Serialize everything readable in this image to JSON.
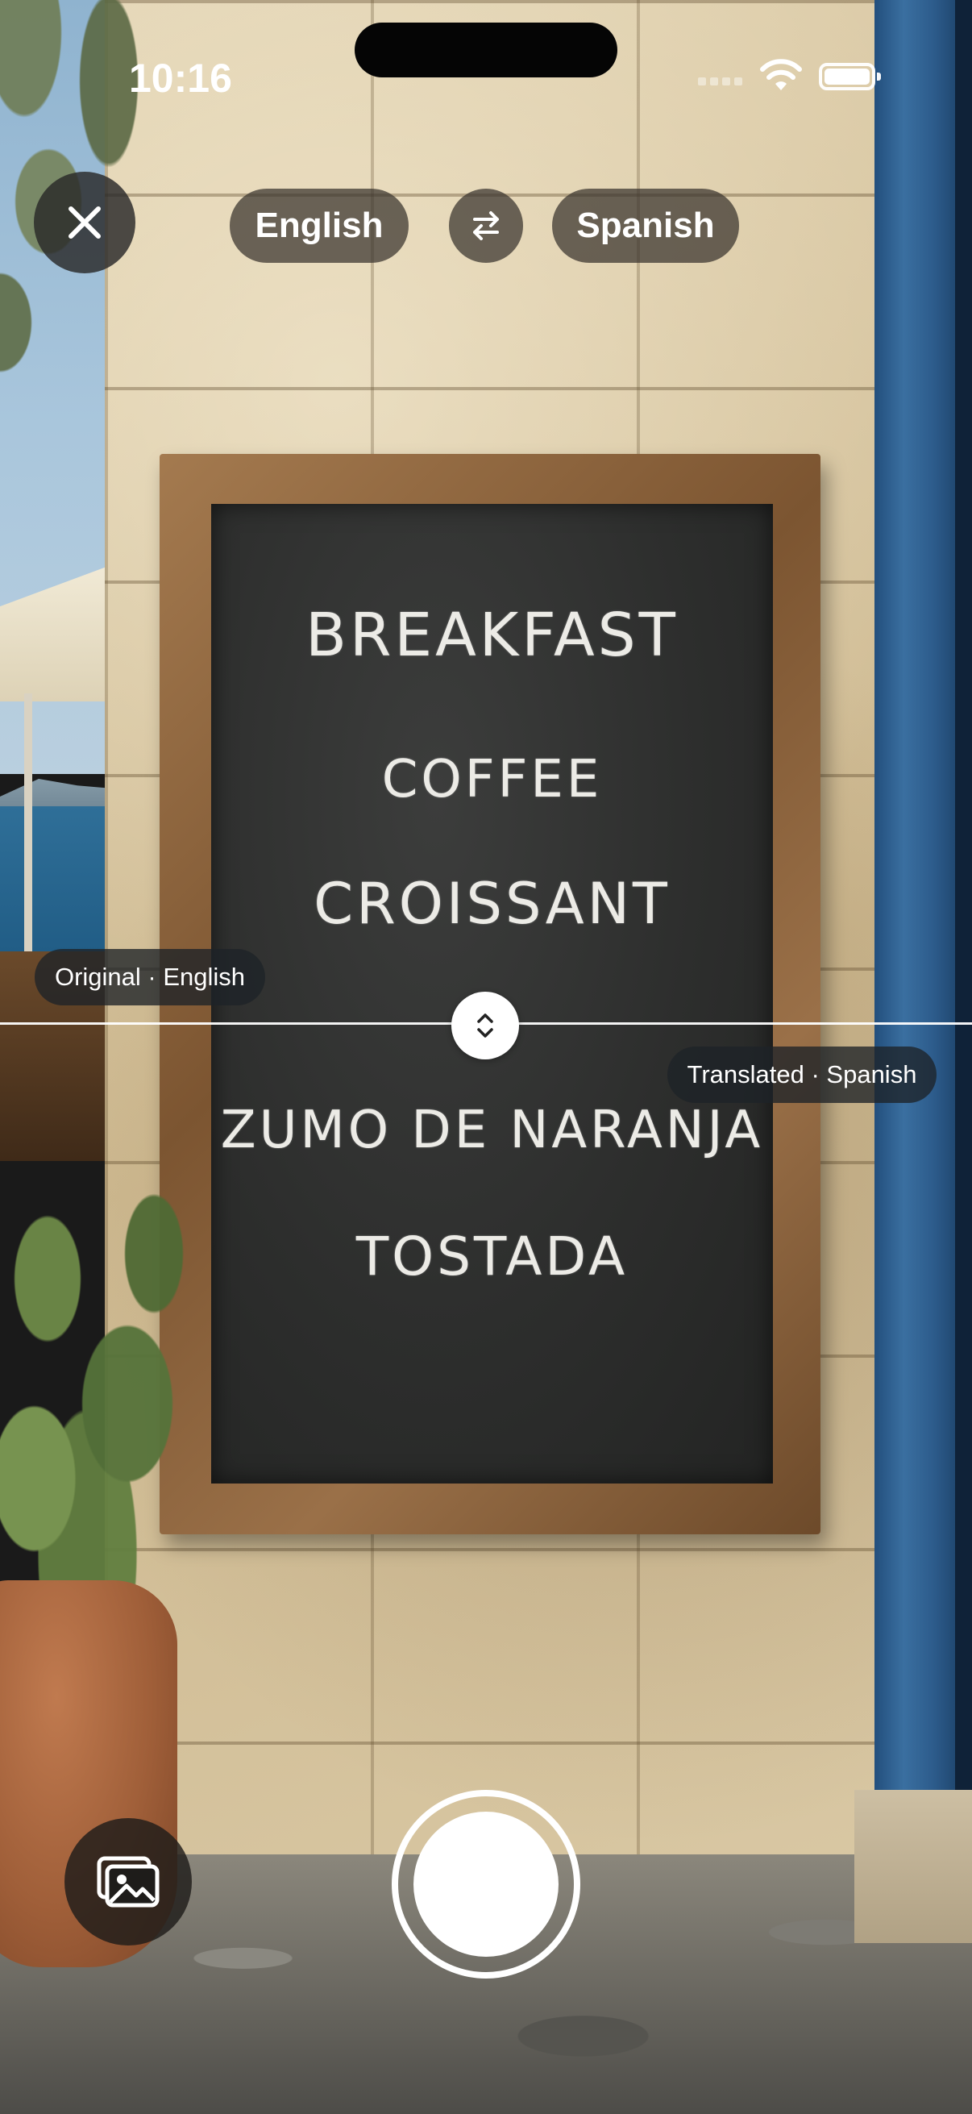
{
  "status_bar": {
    "time": "10:16"
  },
  "header": {
    "close_icon": "close-icon",
    "source_language": "English",
    "swap_icon": "swap-arrows-icon",
    "target_language": "Spanish"
  },
  "camera_view": {
    "chalkboard": {
      "original_lines": [
        "BREAKFAST",
        "COFFEE",
        "CROISSANT"
      ],
      "translated_lines": [
        "ZUMO DE NARANJA",
        "TOSTADA"
      ]
    },
    "original_label": "Original · English",
    "translated_label": "Translated · Spanish",
    "divider_handle_icon": "chevron-up-down-icon"
  },
  "bottom_controls": {
    "gallery_icon": "photo-gallery-icon",
    "shutter_icon": "shutter-button"
  }
}
